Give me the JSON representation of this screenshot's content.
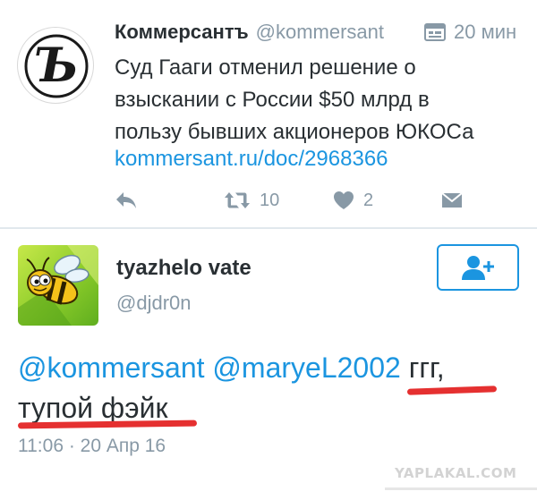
{
  "tweet1": {
    "author_name": "Коммерсантъ",
    "author_handle": "@kommersant",
    "time": "20 мин",
    "text_lines": [
      "Суд Гааги отменил решение о",
      "взыскании с России $50 млрд в",
      "пользу бывших акционеров ЮКОСа"
    ],
    "link": "kommersant.ru/doc/2968366",
    "retweet_count": "10",
    "like_count": "2",
    "icons": {
      "avatar": "kommersant-logo",
      "time": "calendar-icon",
      "reply": "reply-icon",
      "retweet": "retweet-icon",
      "like": "heart-icon",
      "message": "direct-message-icon"
    }
  },
  "tweet2": {
    "author_name": "tyazhelo vate",
    "author_handle": "@djdr0n",
    "mention1": "@kommersant",
    "mention2": "@maryeL2002",
    "text_line1_rest": "ггг,",
    "text_line2": "тупой фэйк",
    "timestamp": "11:06 · 20 Апр 16",
    "icons": {
      "avatar": "bee-avatar",
      "follow": "add-user-icon"
    }
  },
  "watermark": "YAPLAKAL.COM",
  "colors": {
    "link": "#1b95e0",
    "muted": "#8899a6",
    "text": "#292f33",
    "annotation": "#e53030"
  }
}
